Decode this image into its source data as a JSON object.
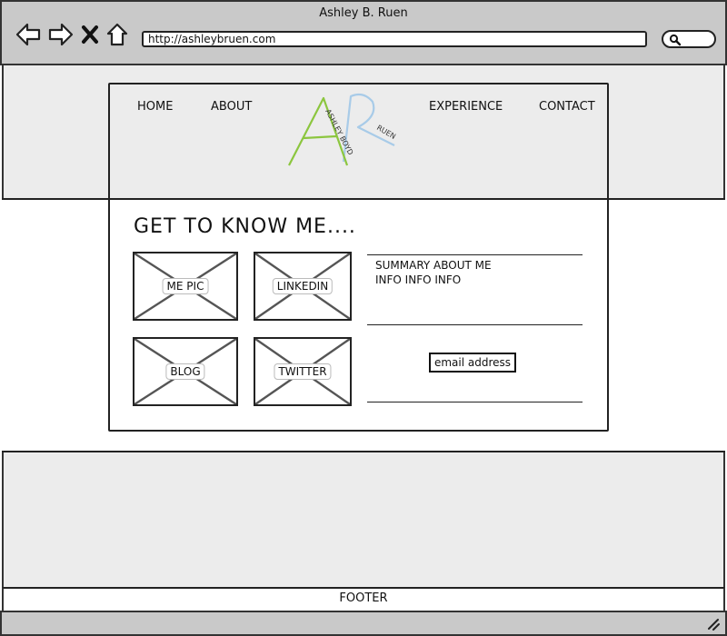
{
  "window": {
    "title": "Ashley B. Ruen"
  },
  "browser": {
    "url": "http://ashleybruen.com"
  },
  "nav": {
    "home": "HOME",
    "about": "ABOUT",
    "experience": "EXPERIENCE",
    "contact": "CONTACT"
  },
  "logo": {
    "big_a": "A",
    "big_r": "R",
    "small_left": "ASHLEY BOYD",
    "small_right": "RUEN"
  },
  "main": {
    "heading": "GET TO KNOW ME....",
    "tiles": [
      "ME PIC",
      "LINKEDIN",
      "BLOG",
      "TWITTER"
    ],
    "summary": "SUMMARY ABOUT ME\nINFO INFO INFO",
    "email_button": "email address"
  },
  "footer": {
    "label": "FOOTER"
  },
  "colors": {
    "logo_a": "#8cc63f",
    "logo_r": "#a8cbe8",
    "chrome": "#c9c9c9",
    "band": "#ececec"
  },
  "icons": [
    "back-arrow-icon",
    "forward-arrow-icon",
    "close-icon",
    "home-icon",
    "search-icon",
    "resize-grip-icon"
  ]
}
